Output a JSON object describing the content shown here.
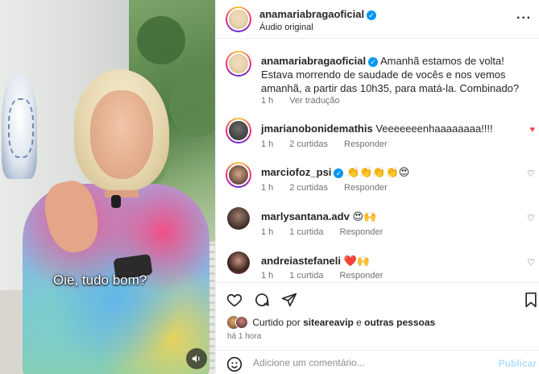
{
  "media": {
    "caption": "Oie, tudo bom?",
    "sound_icon": "speaker-icon"
  },
  "header": {
    "username": "anamariabragaoficial",
    "subtitle": "Áudio original",
    "more_icon": "more-options-icon"
  },
  "post": {
    "username": "anamariabragaoficial",
    "text": "Amanhã estamos de volta! Estava morrendo de saudade de vocês e nos vemos amanhã, a partir das 10h35, para matá-la. Combinado?",
    "time": "1 h",
    "translate": "Ver tradução"
  },
  "comments": [
    {
      "username": "jmarianobonidemathis",
      "text": "Veeeeeeenhaaaaaaaa!!!!",
      "time": "1 h",
      "likes": "2 curtidas",
      "reply": "Responder",
      "liked": true
    },
    {
      "username": "marciofoz_psi",
      "text": "👏👏👏👏😍",
      "time": "1 h",
      "likes": "2 curtidas",
      "reply": "Responder",
      "liked": false,
      "verified": true
    },
    {
      "username": "marlysantana.adv",
      "text": "😍🙌",
      "time": "1 h",
      "likes": "1 curtida",
      "reply": "Responder",
      "liked": false
    },
    {
      "username": "andreiastefaneli",
      "text": "❤️🙌",
      "time": "1 h",
      "likes": "1 curtida",
      "reply": "Responder",
      "liked": false
    }
  ],
  "likes_line": {
    "prefix": "Curtido por",
    "user": "siteareavip",
    "conjunction": "e",
    "others": "outras pessoas"
  },
  "posted_ago": "há 1 hora",
  "add_comment": {
    "placeholder": "Adicione um comentário...",
    "publish": "Publicar"
  },
  "colors": {
    "verified": "#0095f6",
    "liked_heart": "#ed4956",
    "muted_text": "#737373",
    "publish": "#b2dffc"
  }
}
